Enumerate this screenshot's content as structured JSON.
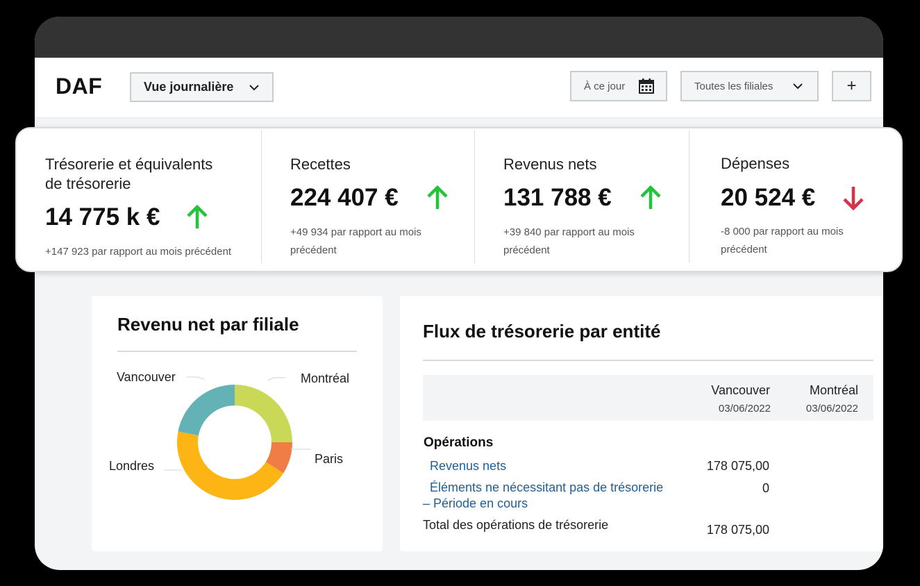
{
  "app": {
    "logo": "DAF"
  },
  "toolbar": {
    "view_label": "Vue journalière",
    "date_label": "À ce jour",
    "filiales_label": "Toutes les filiales",
    "add_label": "+"
  },
  "kpis": [
    {
      "label_line1": "Trésorerie et équivalents",
      "label_line2": "de trésorerie",
      "value": "14 775 k €",
      "trend": "up",
      "note_line1": "+147 923 par rapport au mois précédent",
      "note_line2": ""
    },
    {
      "label_line1": "Recettes",
      "label_line2": "",
      "value": "224 407 €",
      "trend": "up",
      "note_line1": "+49 934 par rapport au mois",
      "note_line2": "précédent"
    },
    {
      "label_line1": "Revenus nets",
      "label_line2": "",
      "value": "131 788 €",
      "trend": "up",
      "note_line1": "+39 840 par rapport au mois",
      "note_line2": "précédent"
    },
    {
      "label_line1": "Dépenses",
      "label_line2": "",
      "value": "20 524 €",
      "trend": "down",
      "note_line1": "-8 000 par rapport au mois",
      "note_line2": "précédent"
    }
  ],
  "colors": {
    "up": "#22c43a",
    "down": "#d6334a",
    "link": "#1f5f96"
  },
  "revenue_panel": {
    "title": "Revenu net par filiale",
    "labels": {
      "vancouver": "Vancouver",
      "montreal": "Montréal",
      "paris": "Paris",
      "londres": "Londres"
    }
  },
  "chart_data": {
    "type": "pie",
    "categories": [
      "Montréal",
      "Paris",
      "Londres",
      "Vancouver"
    ],
    "values": [
      25,
      9,
      44,
      22
    ],
    "colors": [
      "#c9d957",
      "#ef7d45",
      "#fdb515",
      "#63b2b5"
    ],
    "donut": true
  },
  "cashflow_panel": {
    "title": "Flux de trésorerie par entité",
    "columns": [
      {
        "name": "Vancouver",
        "date": "03/06/2022"
      },
      {
        "name": "Montréal",
        "date": "03/06/2022"
      }
    ],
    "section": "Opérations",
    "rows": [
      {
        "label_line1": "Revenus nets",
        "label_line2": "",
        "value": "178 075,00"
      },
      {
        "label_line1": "Éléments ne nécessitant pas de trésorerie",
        "label_line2": "– Période en cours",
        "value": "0"
      }
    ],
    "total": {
      "label": "Total des opérations de trésorerie",
      "value": "178 075,00"
    }
  }
}
